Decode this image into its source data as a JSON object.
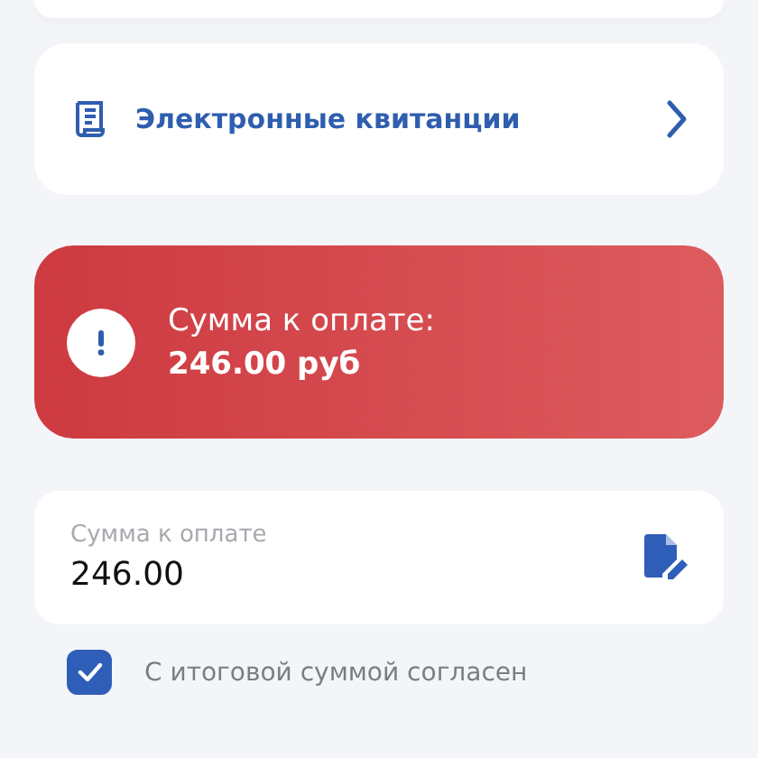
{
  "receipts_link": {
    "label": "Электронные квитанции"
  },
  "alert": {
    "title": "Сумма к оплате:",
    "amount": "246.00 руб"
  },
  "amount_field": {
    "label": "Сумма к оплате",
    "value": "246.00"
  },
  "agree_checkbox": {
    "label": "С итоговой суммой согласен",
    "checked": true
  }
}
